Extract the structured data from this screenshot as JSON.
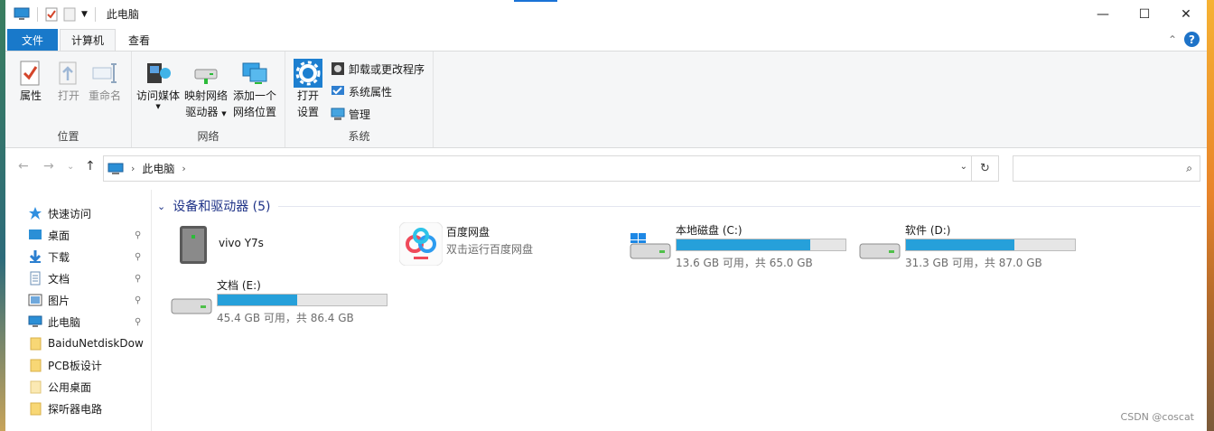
{
  "window": {
    "title": "此电脑",
    "controls": {
      "minimize": "—",
      "maximize": "☐",
      "close": "✕"
    }
  },
  "tabs": {
    "file": "文件",
    "computer": "计算机",
    "view": "查看",
    "collapse": "⌃",
    "help": "?"
  },
  "ribbon": {
    "location": {
      "title": "位置",
      "properties": "属性",
      "open": "打开",
      "rename": "重命名"
    },
    "network": {
      "title": "网络",
      "access_media": "访问媒体",
      "map_drive_1": "映射网络",
      "map_drive_2": "驱动器",
      "add_location_1": "添加一个",
      "add_location_2": "网络位置"
    },
    "system": {
      "title": "系统",
      "open_settings_1": "打开",
      "open_settings_2": "设置",
      "uninstall": "卸载或更改程序",
      "system_properties": "系统属性",
      "manage": "管理"
    }
  },
  "address": {
    "back": "←",
    "forward": "→",
    "recent": "⌄",
    "up": "↑",
    "crumb_sep": "›",
    "location": "此电脑",
    "crumb_end": "›",
    "dropdown": "⌄",
    "refresh": "↻",
    "search_placeholder": "",
    "search_icon": "⌕"
  },
  "nav": {
    "items": [
      {
        "label": "快速访问",
        "pinned": false
      },
      {
        "label": "桌面",
        "pinned": true
      },
      {
        "label": "下载",
        "pinned": true
      },
      {
        "label": "文档",
        "pinned": true
      },
      {
        "label": "图片",
        "pinned": true
      },
      {
        "label": "此电脑",
        "pinned": true
      },
      {
        "label": "BaiduNetdiskDow",
        "pinned": false
      },
      {
        "label": "PCB板设计",
        "pinned": false
      },
      {
        "label": "公用桌面",
        "pinned": false
      },
      {
        "label": "探听器电路",
        "pinned": false
      }
    ],
    "pin_glyph": "📌"
  },
  "content": {
    "section_chevron": "⌄",
    "section_title": "设备和驱动器 (5)",
    "devices": [
      {
        "name": "vivo Y7s",
        "subtitle": ""
      },
      {
        "name": "百度网盘",
        "subtitle": "双击运行百度网盘"
      }
    ],
    "drives": [
      {
        "name": "本地磁盘 (C:)",
        "usage": "13.6 GB 可用，共 65.0 GB",
        "fill_fraction": 0.79
      },
      {
        "name": "软件 (D:)",
        "usage": "31.3 GB 可用，共 87.0 GB",
        "fill_fraction": 0.64
      },
      {
        "name": "文档 (E:)",
        "usage": "45.4 GB 可用，共 86.4 GB",
        "fill_fraction": 0.47
      }
    ]
  },
  "watermark": "CSDN @coscat",
  "colors": {
    "accent": "#1979ca",
    "bar_fill": "#26a0da",
    "section_title": "#1e3287"
  }
}
